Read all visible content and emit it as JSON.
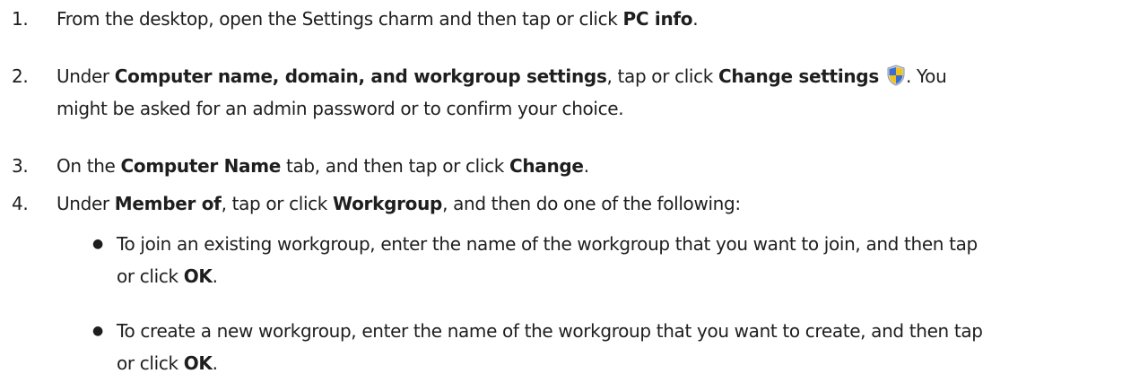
{
  "steps": [
    {
      "number": "1.",
      "parts": [
        "From the desktop, open the Settings charm and then tap or click ",
        "PC info",
        "."
      ]
    },
    {
      "number": "2.",
      "parts": [
        "Under ",
        "Computer name, domain, and workgroup settings",
        ", tap or click ",
        "Change settings",
        ". You",
        "might be asked for an admin password or to confirm your choice."
      ],
      "icon": "uac-shield-icon"
    },
    {
      "number": "3.",
      "parts": [
        "On the ",
        "Computer Name",
        " tab, and then tap or click ",
        "Change",
        "."
      ]
    },
    {
      "number": "4.",
      "parts": [
        "Under ",
        "Member of",
        ", tap or click ",
        "Workgroup",
        ", and then do one of the following:"
      ]
    }
  ],
  "bullets": [
    {
      "parts": [
        "To join an existing workgroup, enter the name of the workgroup that you want to join, and then tap",
        "or click ",
        "OK",
        "."
      ]
    },
    {
      "parts": [
        "To create a new workgroup, enter the name of the workgroup that you want to create, and then tap",
        "or click ",
        "OK",
        "."
      ]
    }
  ],
  "colors": {
    "text": "#1e1e1e",
    "shield_blue": "#3a6fcf",
    "shield_yellow": "#f2c21b"
  }
}
